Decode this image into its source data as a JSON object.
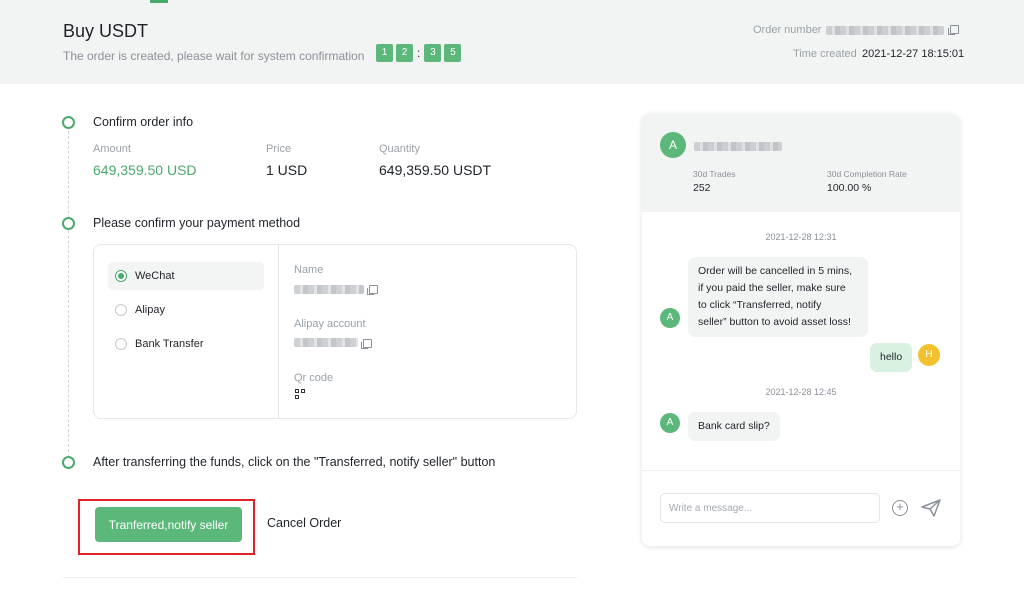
{
  "header": {
    "title": "Buy USDT",
    "subtitle": "The order is created, please wait for system confirmation",
    "countdown": {
      "minutes": [
        "1",
        "2"
      ],
      "separator": ":",
      "seconds": [
        "3",
        "5"
      ]
    },
    "order_number_label": "Order number",
    "time_created_label": "Time created",
    "time_created_value": "2021-12-27 18:15:01"
  },
  "steps": [
    {
      "title": "Confirm order info"
    },
    {
      "title": "Please confirm your payment method"
    },
    {
      "title": "After transferring the funds, click on the \"Transferred, notify seller\" button"
    }
  ],
  "order_info": {
    "amount_label": "Amount",
    "amount_value": "649,359.50 USD",
    "price_label": "Price",
    "price_value": "1 USD",
    "quantity_label": "Quantity",
    "quantity_value": "649,359.50 USDT"
  },
  "payment": {
    "methods": [
      {
        "label": "WeChat",
        "selected": true
      },
      {
        "label": "Alipay",
        "selected": false
      },
      {
        "label": "Bank Transfer",
        "selected": false
      }
    ],
    "name_label": "Name",
    "account_label": "Alipay account",
    "qr_label": "Qr code"
  },
  "actions": {
    "primary_label": "Tranferred,notify seller",
    "cancel_label": "Cancel Order"
  },
  "chat": {
    "seller_avatar": "A",
    "trades_label": "30d Trades",
    "trades_value": "252",
    "completion_label": "30d Completion Rate",
    "completion_value": "100.00 %",
    "messages": [
      {
        "timestamp": "2021-12-28 12:31",
        "avatar": "A",
        "line1": "Order will be cancelled in 5 mins,",
        "line2": "if you paid the seller, make sure",
        "line3": "to click “Transferred, notify",
        "line4": "seller” button to avoid asset loss!"
      },
      {
        "avatar": "H",
        "text": "hello"
      },
      {
        "timestamp": "2021-12-28 12:45",
        "avatar": "A",
        "text": "Bank card slip?"
      }
    ],
    "input_placeholder": "Write a message..."
  },
  "colors": {
    "accent": "#5cb87a",
    "accent_text": "#4aa96c",
    "highlight_frame": "#e0222a",
    "user_avatar": "#f2c12e"
  },
  "icons": [
    "copy-icon",
    "qr-code-icon",
    "plus-circle-icon",
    "send-icon"
  ]
}
